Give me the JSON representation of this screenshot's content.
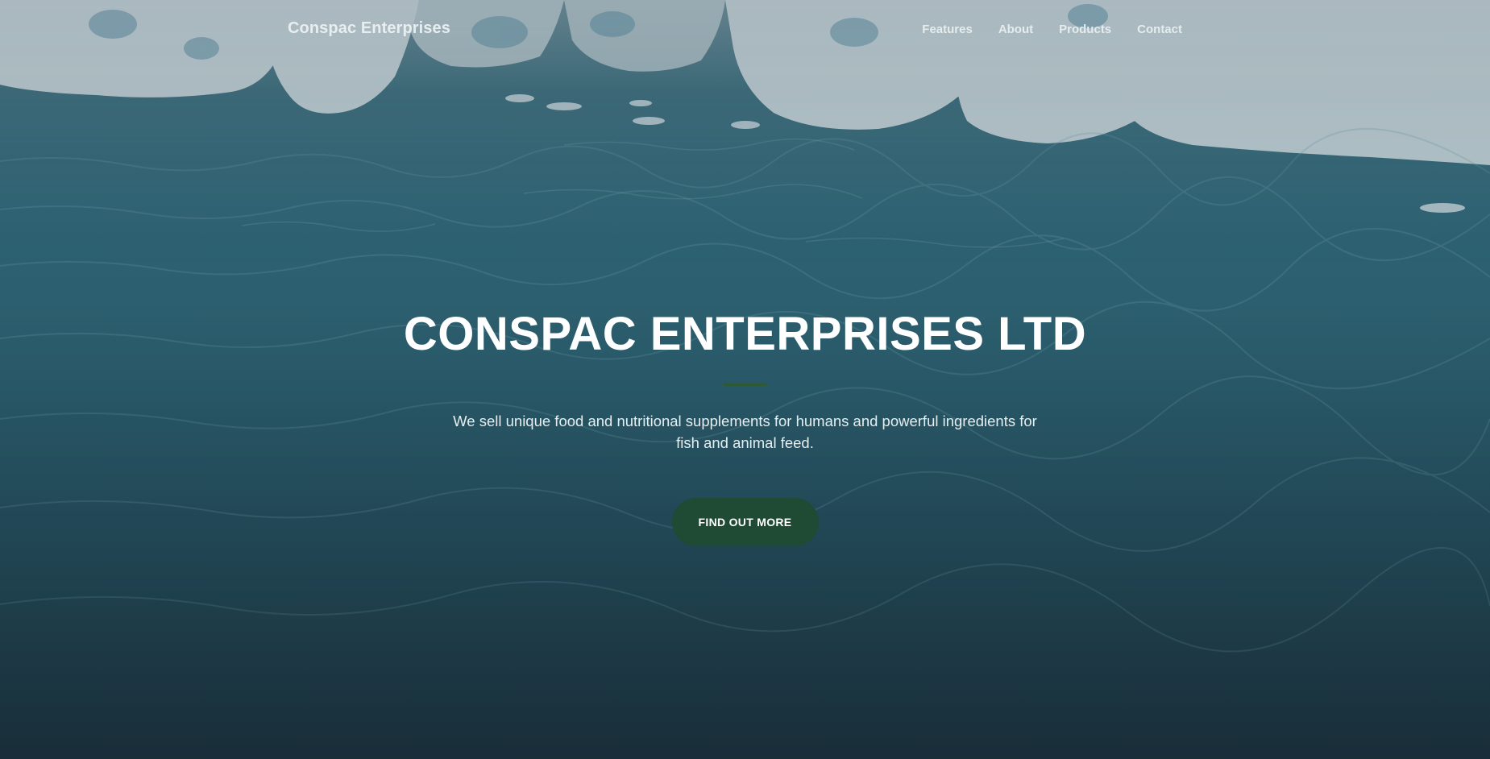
{
  "navbar": {
    "brand": "Conspac Enterprises",
    "links": [
      {
        "label": "Features"
      },
      {
        "label": "About"
      },
      {
        "label": "Products"
      },
      {
        "label": "Contact"
      }
    ]
  },
  "masthead": {
    "title": "CONSPAC ENTERPRISES LTD",
    "subtitle": "We sell unique food and nutritional supplements for humans and powerful ingredients for fish and animal feed.",
    "cta_label": "FIND OUT MORE"
  },
  "colors": {
    "accent_green": "#1f4a33",
    "divider_green": "#2d5a34",
    "water_blue": "#2f6677"
  }
}
